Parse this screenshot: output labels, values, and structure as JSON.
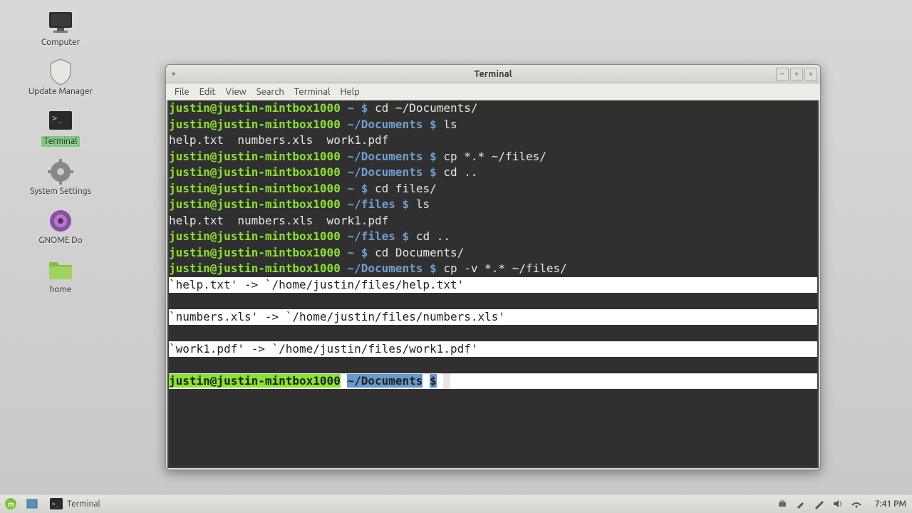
{
  "desktop": {
    "icons": [
      {
        "name": "computer",
        "label": "Computer"
      },
      {
        "name": "update-manager",
        "label": "Update Manager"
      },
      {
        "name": "terminal",
        "label": "Terminal",
        "active": true
      },
      {
        "name": "system-settings",
        "label": "System Settings"
      },
      {
        "name": "gnome-do",
        "label": "GNOME Do"
      },
      {
        "name": "home",
        "label": "home"
      }
    ]
  },
  "window": {
    "title": "Terminal",
    "menu": [
      "File",
      "Edit",
      "View",
      "Search",
      "Terminal",
      "Help"
    ]
  },
  "terminal": {
    "lines": [
      {
        "user": "justin@justin-mintbox1000",
        "path": "~",
        "cmd": "cd ~/Documents/"
      },
      {
        "user": "justin@justin-mintbox1000",
        "path": "~/Documents",
        "cmd": "ls"
      },
      {
        "out": "help.txt  numbers.xls  work1.pdf"
      },
      {
        "user": "justin@justin-mintbox1000",
        "path": "~/Documents",
        "cmd": "cp *.* ~/files/"
      },
      {
        "user": "justin@justin-mintbox1000",
        "path": "~/Documents",
        "cmd": "cd .."
      },
      {
        "user": "justin@justin-mintbox1000",
        "path": "~",
        "cmd": "cd files/"
      },
      {
        "user": "justin@justin-mintbox1000",
        "path": "~/files",
        "cmd": "ls"
      },
      {
        "out": "help.txt  numbers.xls  work1.pdf"
      },
      {
        "user": "justin@justin-mintbox1000",
        "path": "~/files",
        "cmd": "cd .."
      },
      {
        "user": "justin@justin-mintbox1000",
        "path": "~",
        "cmd": "cd Documents/"
      },
      {
        "user": "justin@justin-mintbox1000",
        "path": "~/Documents",
        "cmd": "cp -v *.* ~/files/"
      },
      {
        "sel": true,
        "out": "`help.txt' -> `/home/justin/files/help.txt'"
      },
      {
        "sel": true,
        "out": "`numbers.xls' -> `/home/justin/files/numbers.xls'"
      },
      {
        "sel": true,
        "out": "`work1.pdf' -> `/home/justin/files/work1.pdf'"
      },
      {
        "sel": true,
        "user": "justin@justin-mintbox1000",
        "path": "~/Documents",
        "cmd": "",
        "cursor": true
      }
    ]
  },
  "taskbar": {
    "app": "Terminal",
    "clock": "7:41 PM"
  }
}
